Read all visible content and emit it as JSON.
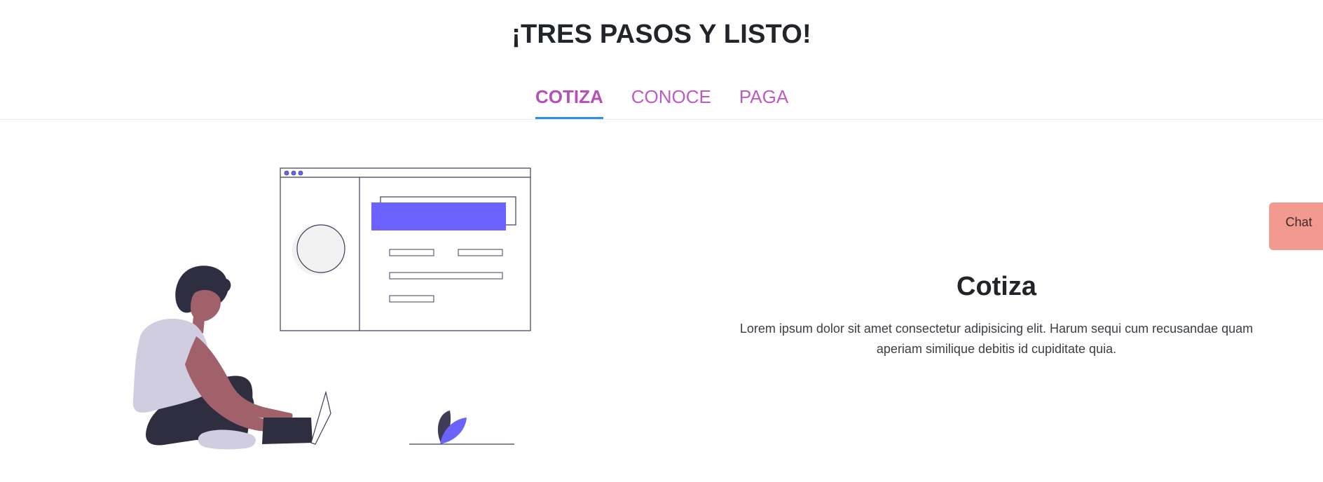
{
  "header": {
    "title": "¡TRES PASOS Y LISTO!"
  },
  "tabs": [
    {
      "label": "COTIZA",
      "active": true
    },
    {
      "label": "CONOCE",
      "active": false
    },
    {
      "label": "PAGA",
      "active": false
    }
  ],
  "main": {
    "heading": "Cotiza",
    "description": "Lorem ipsum dolor sit amet consectetur adipisicing elit. Harum sequi cum recusandae quam aperiam similique debitis id cupiditate quia."
  },
  "chat": {
    "label": "Chat"
  },
  "colors": {
    "tab_text": "#c05bc3",
    "tab_indicator": "#2d8cf0",
    "chat_bg": "#f39a90",
    "illustration_accent": "#6c63ff"
  }
}
